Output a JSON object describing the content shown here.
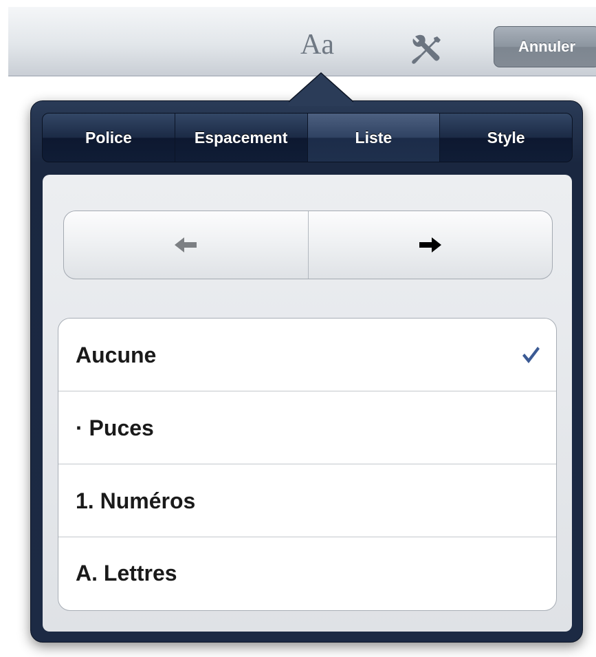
{
  "toolbar": {
    "format_button_label": "Aa",
    "tools_icon": "wrench-screwdriver-icon",
    "cancel_label": "Annuler"
  },
  "popover": {
    "tabs": [
      {
        "label": "Police",
        "active": false
      },
      {
        "label": "Espacement",
        "active": false
      },
      {
        "label": "Liste",
        "active": true
      },
      {
        "label": "Style",
        "active": false
      }
    ],
    "indent": {
      "left_icon": "arrow-left-icon",
      "left_enabled": false,
      "right_icon": "arrow-right-icon",
      "right_enabled": true
    },
    "list_styles": [
      {
        "label": "Aucune",
        "selected": true
      },
      {
        "label": "· Puces",
        "selected": false
      },
      {
        "label": "1. Numéros",
        "selected": false
      },
      {
        "label": "A. Lettres",
        "selected": false
      }
    ]
  },
  "colors": {
    "check": "#3b5a94",
    "popover_dark": "#1a2740",
    "arrow_disabled": "#7c7f83",
    "arrow_enabled": "#000000"
  }
}
